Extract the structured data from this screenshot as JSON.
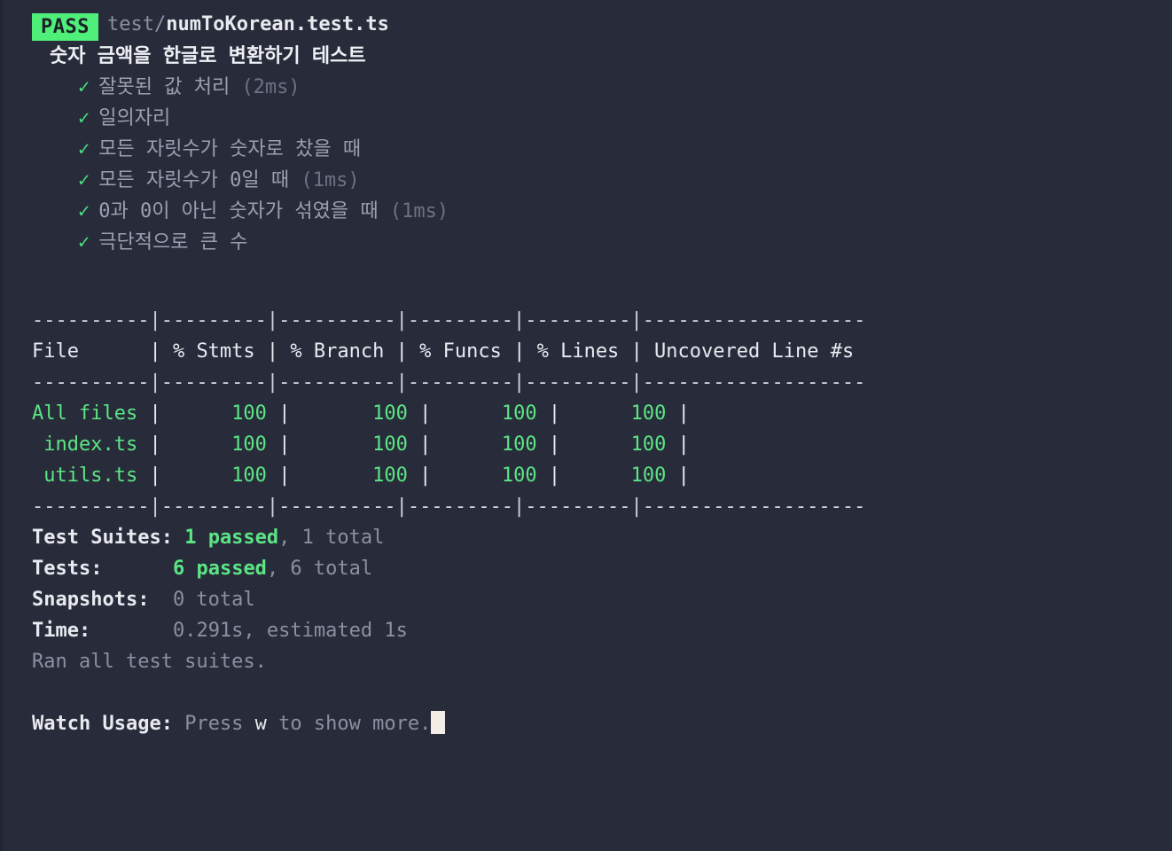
{
  "terminal": {
    "background": "#282c3a",
    "foreground": "#d8dae3",
    "accent_green": "#5be584",
    "badge_green": "#4ef07a",
    "dim_gray": "#8b90a0"
  },
  "suite": {
    "status_badge": "PASS",
    "path_prefix": "test/",
    "file_name": "numToKorean.test.ts",
    "describe": "숫자 금액을 한글로 변환하기 테스트",
    "check_icon": "✓",
    "tests": [
      {
        "name": "잘못된 값 처리",
        "duration": "(2ms)"
      },
      {
        "name": "일의자리",
        "duration": ""
      },
      {
        "name": "모든 자릿수가 숫자로 찼을 때",
        "duration": ""
      },
      {
        "name": "모든 자릿수가 0일 때",
        "duration": "(1ms)"
      },
      {
        "name": "0과 0이 아닌 숫자가 섞였을 때",
        "duration": "(1ms)"
      },
      {
        "name": "극단적으로 큰 수",
        "duration": ""
      }
    ]
  },
  "coverage": {
    "separator": "----------|---------|----------|---------|---------|-------------------",
    "header": {
      "file": "File      ",
      "stmts": " % Stmts ",
      "branch": " % Branch ",
      "funcs": " % Funcs ",
      "lines": " % Lines ",
      "uncovered": " Uncovered Line #s "
    },
    "columns": [
      "File",
      "% Stmts",
      "% Branch",
      "% Funcs",
      "% Lines",
      "Uncovered Line #s"
    ],
    "rows": [
      {
        "file": "All files",
        "file_cell": "All files ",
        "stmts": "100",
        "branch": "100",
        "funcs": "100",
        "lines": "100",
        "uncovered": ""
      },
      {
        "file": "index.ts",
        "file_cell": " index.ts ",
        "stmts": "100",
        "branch": "100",
        "funcs": "100",
        "lines": "100",
        "uncovered": ""
      },
      {
        "file": "utils.ts",
        "file_cell": " utils.ts ",
        "stmts": "100",
        "branch": "100",
        "funcs": "100",
        "lines": "100",
        "uncovered": ""
      }
    ]
  },
  "summary": {
    "suites_label": "Test Suites:",
    "suites_passed": "1 passed",
    "suites_rest": ", 1 total",
    "tests_label": "Tests:",
    "tests_pad": "      ",
    "tests_passed": "6 passed",
    "tests_rest": ", 6 total",
    "snapshots_label": "Snapshots:",
    "snapshots_value": "  0 total",
    "time_label": "Time:",
    "time_pad": "       ",
    "time_value": "0.291s, estimated 1s",
    "ran_all": "Ran all test suites."
  },
  "watch": {
    "label": "Watch Usage:",
    "press": " Press ",
    "key": "w",
    "rest": " to show more."
  }
}
